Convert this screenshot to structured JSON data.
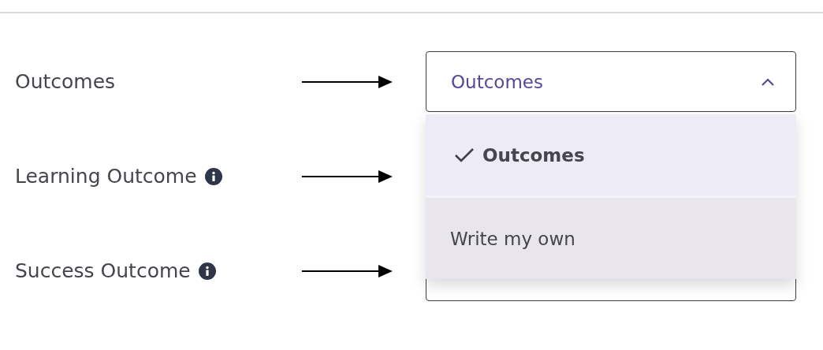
{
  "rows": [
    {
      "label": "Outcomes",
      "info": false
    },
    {
      "label": "Learning Outcome",
      "info": true
    },
    {
      "label": "Success Outcome",
      "info": true
    }
  ],
  "select": {
    "value": "Outcomes",
    "expanded": true,
    "options": [
      {
        "label": "Outcomes",
        "selected": true
      },
      {
        "label": "Write my own",
        "selected": false
      }
    ]
  }
}
